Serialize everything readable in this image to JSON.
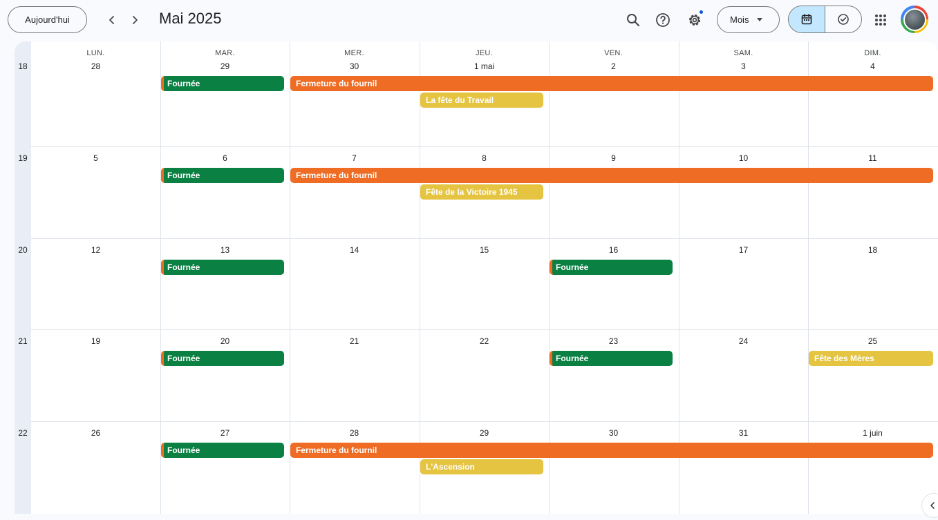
{
  "header": {
    "today_label": "Aujourd'hui",
    "month_title": "Mai 2025",
    "view_label": "Mois"
  },
  "weekdays": [
    "LUN.",
    "MAR.",
    "MER.",
    "JEU.",
    "VEN.",
    "SAM.",
    "DIM."
  ],
  "weeks": [
    {
      "number": "18",
      "days": [
        "28",
        "29",
        "30",
        "1 mai",
        "2",
        "3",
        "4"
      ]
    },
    {
      "number": "19",
      "days": [
        "5",
        "6",
        "7",
        "8",
        "9",
        "10",
        "11"
      ]
    },
    {
      "number": "20",
      "days": [
        "12",
        "13",
        "14",
        "15",
        "16",
        "17",
        "18"
      ]
    },
    {
      "number": "21",
      "days": [
        "19",
        "20",
        "21",
        "22",
        "23",
        "24",
        "25"
      ]
    },
    {
      "number": "22",
      "days": [
        "26",
        "27",
        "28",
        "29",
        "30",
        "31",
        "1 juin"
      ]
    }
  ],
  "events": [
    {
      "week": 0,
      "start": 1,
      "span": 1,
      "row": 0,
      "title": "Fournée",
      "kind": "green"
    },
    {
      "week": 0,
      "start": 2,
      "span": 5,
      "row": 0,
      "title": "Fermeture du fournil",
      "kind": "orange"
    },
    {
      "week": 0,
      "start": 3,
      "span": 1,
      "row": 1,
      "title": "La fête du Travail",
      "kind": "yellow"
    },
    {
      "week": 1,
      "start": 1,
      "span": 1,
      "row": 0,
      "title": "Fournée",
      "kind": "green"
    },
    {
      "week": 1,
      "start": 2,
      "span": 5,
      "row": 0,
      "title": "Fermeture du fournil",
      "kind": "orange"
    },
    {
      "week": 1,
      "start": 3,
      "span": 1,
      "row": 1,
      "title": "Fête de la Victoire 1945",
      "kind": "yellow"
    },
    {
      "week": 2,
      "start": 1,
      "span": 1,
      "row": 0,
      "title": "Fournée",
      "kind": "green"
    },
    {
      "week": 2,
      "start": 4,
      "span": 1,
      "row": 0,
      "title": "Fournée",
      "kind": "green"
    },
    {
      "week": 3,
      "start": 1,
      "span": 1,
      "row": 0,
      "title": "Fournée",
      "kind": "green"
    },
    {
      "week": 3,
      "start": 4,
      "span": 1,
      "row": 0,
      "title": "Fournée",
      "kind": "green"
    },
    {
      "week": 3,
      "start": 6,
      "span": 1,
      "row": 0,
      "title": "Fête des Mères",
      "kind": "yellow"
    },
    {
      "week": 4,
      "start": 1,
      "span": 1,
      "row": 0,
      "title": "Fournée",
      "kind": "green"
    },
    {
      "week": 4,
      "start": 2,
      "span": 5,
      "row": 0,
      "title": "Fermeture du fournil",
      "kind": "orange"
    },
    {
      "week": 4,
      "start": 3,
      "span": 1,
      "row": 1,
      "title": "L'Ascension",
      "kind": "yellow"
    }
  ],
  "colors": {
    "event_green": "#0b8043",
    "event_orange": "#ef6c24",
    "event_yellow": "#e4c441",
    "active_view": "#c2e7ff"
  },
  "icons": [
    "chevron-left-icon",
    "chevron-right-icon",
    "search-icon",
    "help-icon",
    "settings-icon",
    "calendar-icon",
    "tasks-icon",
    "apps-grid-icon",
    "chevron-left-small-icon"
  ]
}
